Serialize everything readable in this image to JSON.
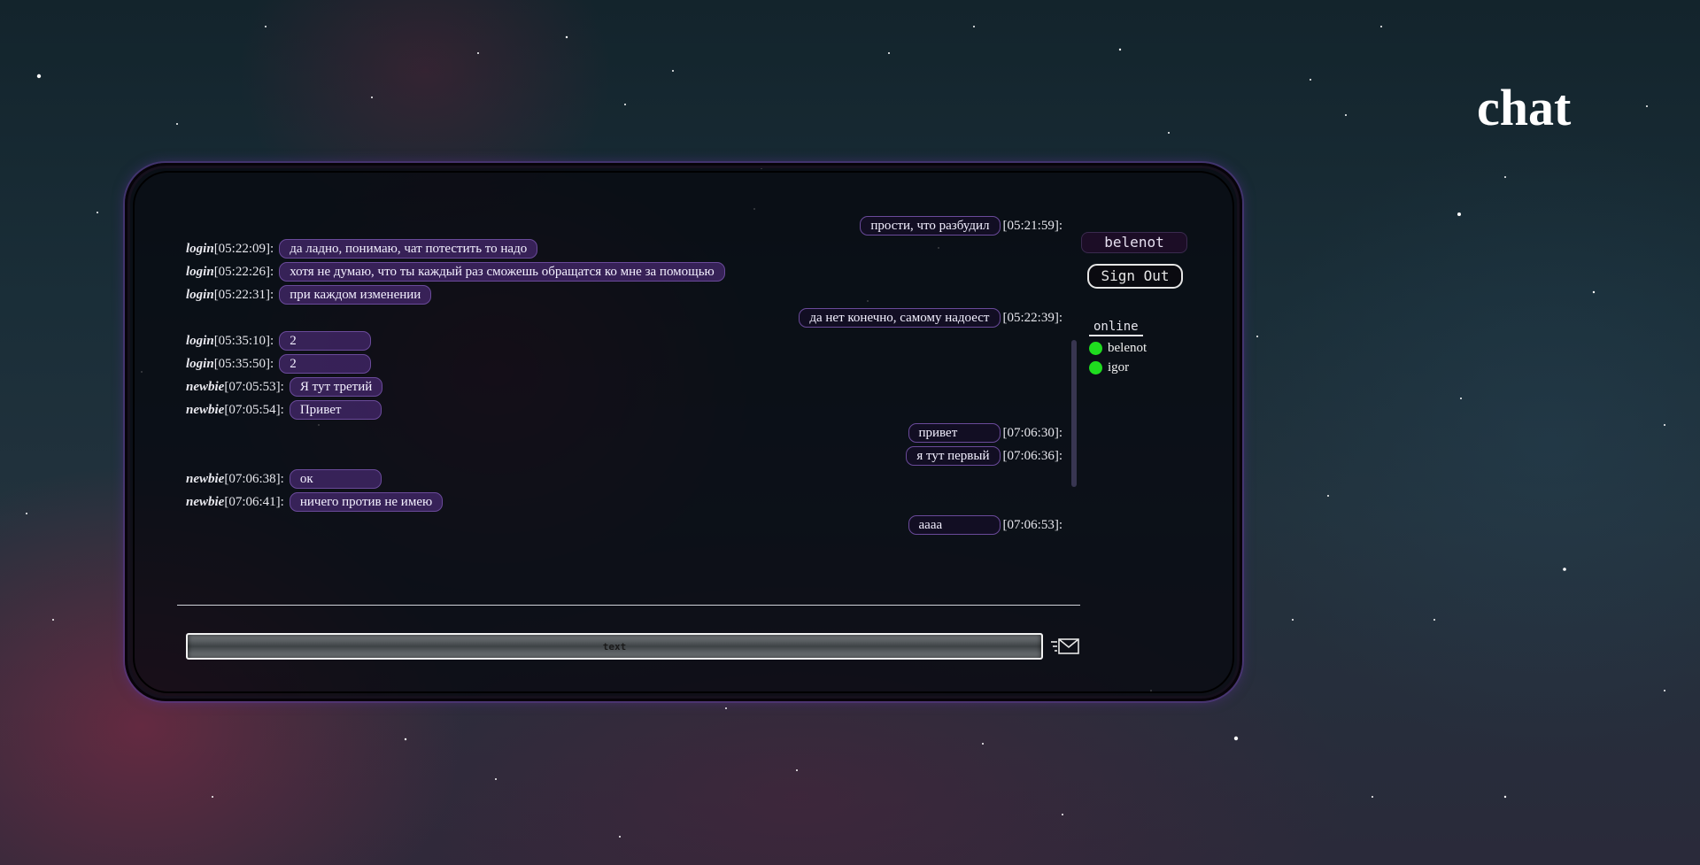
{
  "page": {
    "title": "chat"
  },
  "user": {
    "name": "belenot",
    "sign_out_label": "Sign Out"
  },
  "online": {
    "title": "online",
    "users": [
      {
        "name": "belenot",
        "status_color": "#1fdc1f"
      },
      {
        "name": "igor",
        "status_color": "#1fdc1f"
      }
    ]
  },
  "input": {
    "placeholder": "text"
  },
  "send_button": {
    "icon": "envelope-send-icon"
  },
  "messages": [
    {
      "side": "right",
      "author": "",
      "time": "[05:21:59]:",
      "text": "прости, что разбудил"
    },
    {
      "side": "left",
      "author": "login",
      "time": "[05:22:09]:",
      "text": "да ладно, понимаю, чат потестить то надо"
    },
    {
      "side": "left",
      "author": "login",
      "time": "[05:22:26]:",
      "text": "хотя не думаю, что ты каждый раз сможешь обращатся ко мне за помощью"
    },
    {
      "side": "left",
      "author": "login",
      "time": "[05:22:31]:",
      "text": "при каждом изменении"
    },
    {
      "side": "right",
      "author": "",
      "time": "[05:22:39]:",
      "text": "да нет конечно, самому надоест"
    },
    {
      "side": "left",
      "author": "login",
      "time": "[05:35:10]:",
      "text": "2"
    },
    {
      "side": "left",
      "author": "login",
      "time": "[05:35:50]:",
      "text": "2"
    },
    {
      "side": "left",
      "author": "newbie",
      "time": "[07:05:53]:",
      "text": "Я тут третий"
    },
    {
      "side": "left",
      "author": "newbie",
      "time": "[07:05:54]:",
      "text": "Привет"
    },
    {
      "side": "right",
      "author": "",
      "time": "[07:06:30]:",
      "text": "привет"
    },
    {
      "side": "right",
      "author": "",
      "time": "[07:06:36]:",
      "text": "я тут первый"
    },
    {
      "side": "left",
      "author": "newbie",
      "time": "[07:06:38]:",
      "text": "ок"
    },
    {
      "side": "left",
      "author": "newbie",
      "time": "[07:06:41]:",
      "text": "ничего против не имею"
    },
    {
      "side": "right",
      "author": "",
      "time": "[07:06:53]:",
      "text": "аааа"
    }
  ]
}
